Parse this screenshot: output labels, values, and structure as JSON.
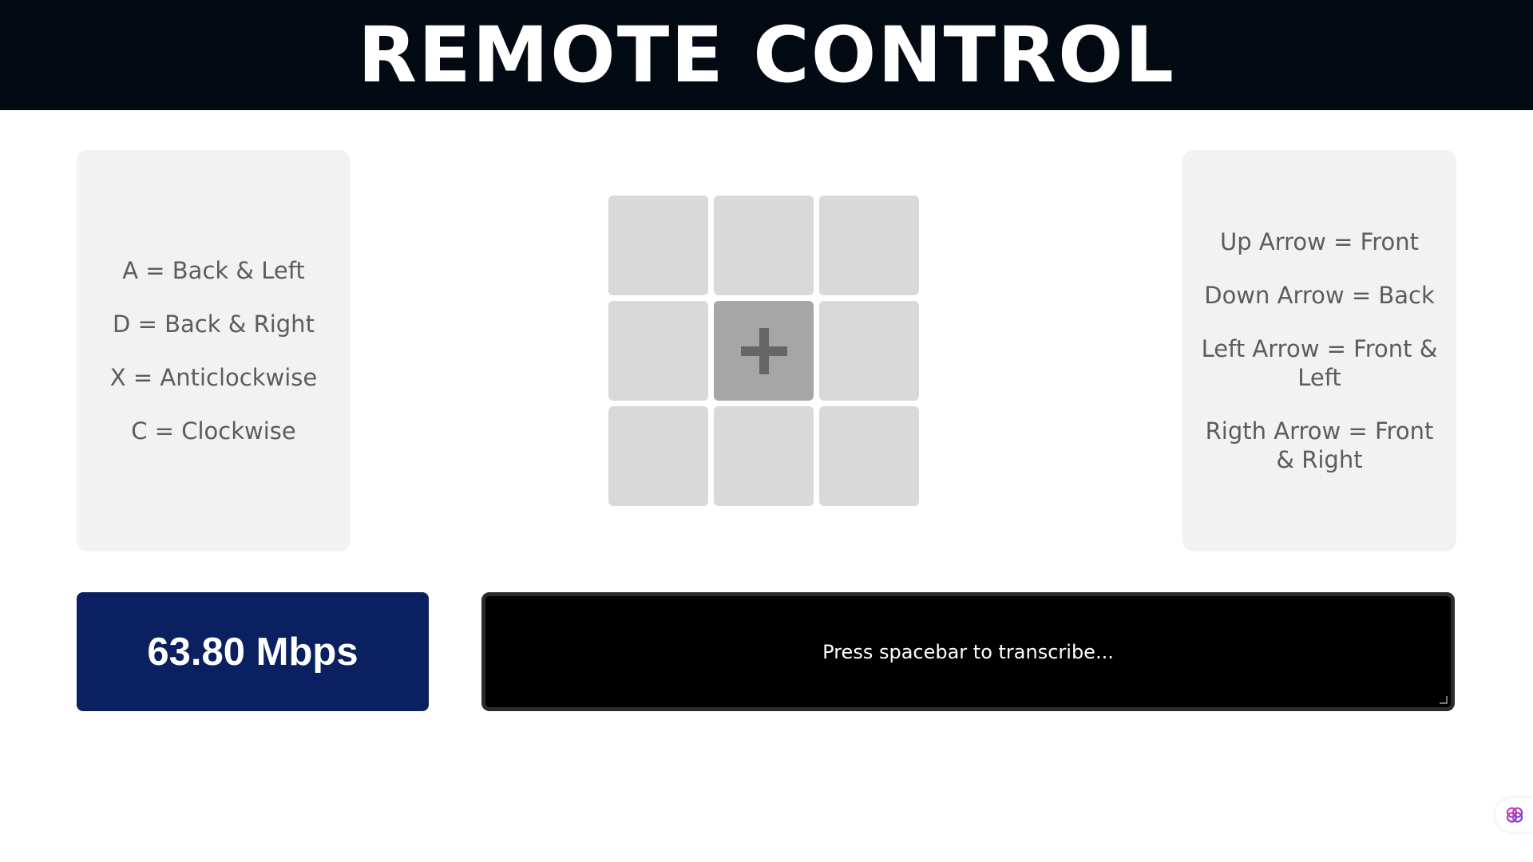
{
  "header": {
    "title": "REMOTE CONTROL"
  },
  "left_panel": {
    "items": [
      "A = Back & Left",
      "D = Back & Right",
      "X = Anticlockwise",
      "C = Clockwise"
    ]
  },
  "right_panel": {
    "items": [
      "Up Arrow = Front",
      "Down Arrow = Back",
      "Left Arrow = Front & Left",
      "Rigth Arrow = Front & Right"
    ]
  },
  "direction_pad": {
    "center_icon": "plus-icon"
  },
  "speed": {
    "value": "63.80 Mbps"
  },
  "transcription": {
    "placeholder": "Press spacebar to transcribe..."
  },
  "extension_button": {
    "icon": "brain-icon"
  },
  "colors": {
    "header_bg": "#040a14",
    "panel_bg": "#f2f2f2",
    "pad_cell": "#d9d9d9",
    "pad_center": "#a6a6a6",
    "speed_bg": "#0b2060",
    "transcribe_bg": "#000000"
  }
}
